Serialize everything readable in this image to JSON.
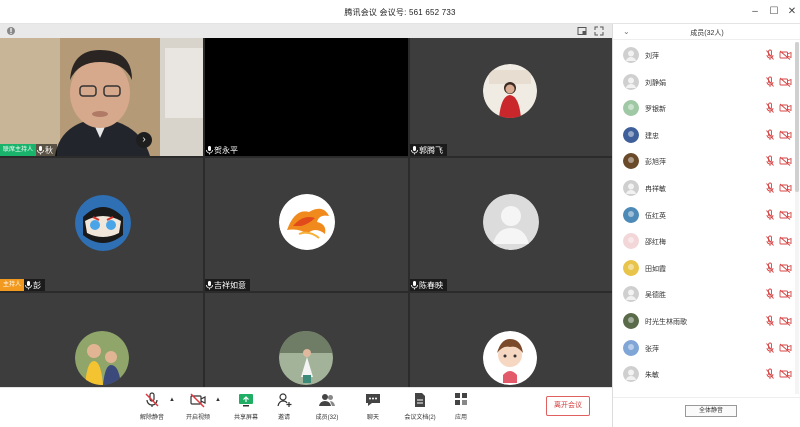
{
  "window": {
    "title": "腾讯会议 会议号: 561 652 733",
    "controls": [
      "minimize",
      "maximize",
      "close"
    ]
  },
  "tiles": [
    {
      "name": "秋",
      "tag": "联席主持人",
      "tag_color": "#19b36b",
      "kind": "camera"
    },
    {
      "name": "贺永平",
      "tag": "",
      "kind": "blank"
    },
    {
      "name": "郭腾飞",
      "tag": "",
      "kind": "avatar",
      "avatar": "woman-in-red"
    },
    {
      "name": "彭",
      "tag": "主持人",
      "tag_color": "#f29a1f",
      "kind": "avatar",
      "avatar": "cartoon-mask"
    },
    {
      "name": "吉祥如意",
      "tag": "",
      "kind": "avatar",
      "avatar": "fire-dragon"
    },
    {
      "name": "陈春映",
      "tag": "",
      "kind": "avatar",
      "avatar": "default-person"
    },
    {
      "name": "",
      "tag": "",
      "kind": "avatar",
      "avatar": "children-photo"
    },
    {
      "name": "",
      "tag": "",
      "kind": "avatar",
      "avatar": "garden-photo"
    },
    {
      "name": "",
      "tag": "",
      "kind": "avatar",
      "avatar": "cartoon-girl"
    }
  ],
  "bottombar": {
    "controls": [
      {
        "id": "mic",
        "label": "解除静音",
        "icon": "mic-muted-icon"
      },
      {
        "id": "video",
        "label": "开启视频",
        "icon": "camera-off-icon"
      },
      {
        "id": "share",
        "label": "共享屏幕",
        "icon": "share-screen-icon"
      },
      {
        "id": "invite",
        "label": "邀请",
        "icon": "invite-icon"
      },
      {
        "id": "members",
        "label": "成员(32)",
        "icon": "members-icon"
      },
      {
        "id": "chat",
        "label": "聊天",
        "icon": "chat-icon"
      },
      {
        "id": "docs",
        "label": "会议文档(2)",
        "icon": "document-icon"
      },
      {
        "id": "apps",
        "label": "应用",
        "icon": "apps-icon"
      }
    ],
    "leave_label": "离开会议"
  },
  "panel": {
    "title": "成员(32人)",
    "mute_all_label": "全体静音",
    "members": [
      {
        "name": "刘萍",
        "avatar": "gray"
      },
      {
        "name": "刘静娟",
        "avatar": "gray"
      },
      {
        "name": "罗银新",
        "avatar": "green-photo"
      },
      {
        "name": "建忠",
        "avatar": "blue-photo"
      },
      {
        "name": "彭旭萍",
        "avatar": "brown-photo"
      },
      {
        "name": "冉祥敏",
        "avatar": "gray"
      },
      {
        "name": "伍红英",
        "avatar": "lake-photo"
      },
      {
        "name": "邵红梅",
        "avatar": "flower-photo"
      },
      {
        "name": "田如霞",
        "avatar": "yellow-photo"
      },
      {
        "name": "吴德胜",
        "avatar": "gray"
      },
      {
        "name": "时光生林雨歌",
        "avatar": "tree-photo"
      },
      {
        "name": "张萍",
        "avatar": "sky-photo"
      },
      {
        "name": "朱敏",
        "avatar": "gray"
      }
    ]
  }
}
